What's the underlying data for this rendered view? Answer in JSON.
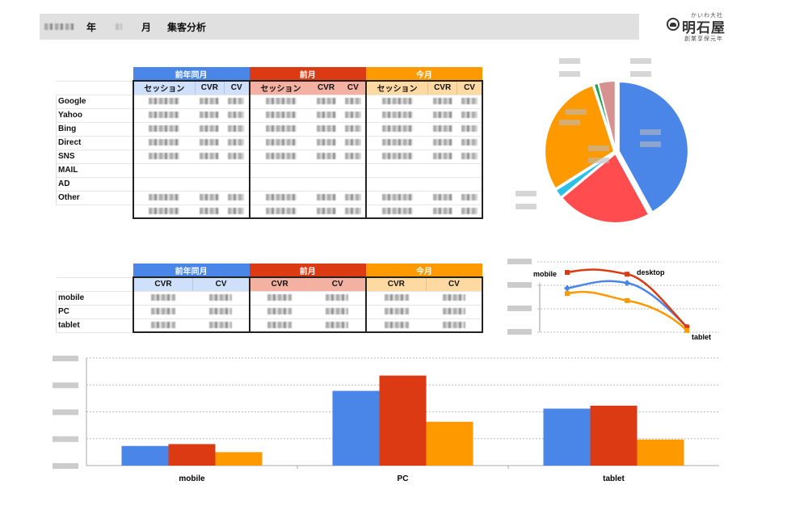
{
  "header": {
    "year_value": "█████",
    "year_suffix": "年",
    "month_value": "█",
    "month_suffix": "月",
    "title": "集客分析"
  },
  "logo": {
    "tagline": "かいわ大社",
    "name": "明石屋",
    "subtitle": "創業享保元年"
  },
  "colors": {
    "prev_year": "#4a86e8",
    "prev_month": "#dc3a13",
    "this_month": "#ff9900"
  },
  "source_table": {
    "groups": [
      "前年同月",
      "前月",
      "今月"
    ],
    "subheaders": [
      "セッション",
      "CVR",
      "CV"
    ],
    "rows": [
      "Google",
      "Yahoo",
      "Bing",
      "Direct",
      "SNS",
      "MAIL",
      "AD",
      "Other",
      ""
    ],
    "values_redacted": true
  },
  "device_table": {
    "groups": [
      "前年同月",
      "前月",
      "今月"
    ],
    "subheaders": [
      "CVR",
      "CV"
    ],
    "rows": [
      "mobile",
      "PC",
      "tablet"
    ],
    "values_redacted": true
  },
  "chart_data": [
    {
      "type": "pie",
      "title": "",
      "labels": [
        "Google",
        "Yahoo",
        "Bing",
        "Direct",
        "SNS",
        "Other"
      ],
      "values": [
        42,
        22,
        2,
        29,
        1,
        4
      ],
      "colors": [
        "#4a86e8",
        "#ff4d4f",
        "#2dbfe8",
        "#ff9900",
        "#1aa349",
        "#d69191"
      ],
      "labels_redacted": true
    },
    {
      "type": "line",
      "categories": [
        "mobile",
        "desktop",
        "tablet"
      ],
      "series": [
        {
          "name": "前年同月",
          "color": "#4a86e8",
          "values": [
            2.5,
            2.8,
            0.3
          ]
        },
        {
          "name": "前月",
          "color": "#dc3a13",
          "values": [
            3.4,
            3.3,
            0.3
          ]
        },
        {
          "name": "今月",
          "color": "#ff9900",
          "values": [
            2.2,
            1.8,
            0.1
          ]
        }
      ],
      "ylim": [
        0,
        4
      ],
      "yticks_redacted": true
    },
    {
      "type": "bar",
      "categories": [
        "mobile",
        "PC",
        "tablet"
      ],
      "series": [
        {
          "name": "前年同月",
          "color": "#4a86e8",
          "values": [
            0.73,
            2.78,
            2.12
          ]
        },
        {
          "name": "前月",
          "color": "#dc3a13",
          "values": [
            0.8,
            3.35,
            2.23
          ]
        },
        {
          "name": "今月",
          "color": "#ff9900",
          "values": [
            0.5,
            1.63,
            0.97
          ]
        }
      ],
      "ylim": [
        0,
        4
      ],
      "grid": true,
      "yticks_redacted": true
    }
  ]
}
